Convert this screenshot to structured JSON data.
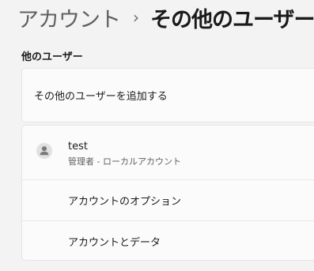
{
  "breadcrumb": {
    "parent": "アカウント",
    "separator": "›",
    "current": "その他のユーザー"
  },
  "section": {
    "title": "他のユーザー"
  },
  "add_user": {
    "label": "その他のユーザーを追加する"
  },
  "user": {
    "name": "test",
    "account_type": "管理者 - ローカルアカウント",
    "icon": "person-icon"
  },
  "options": {
    "account_options": "アカウントのオプション",
    "account_data": "アカウントとデータ"
  },
  "colors": {
    "background": "#f3f3f3",
    "card": "#fbfbfb",
    "avatar_bg": "#e1e1e1",
    "avatar_fg": "#7a7a7a"
  }
}
